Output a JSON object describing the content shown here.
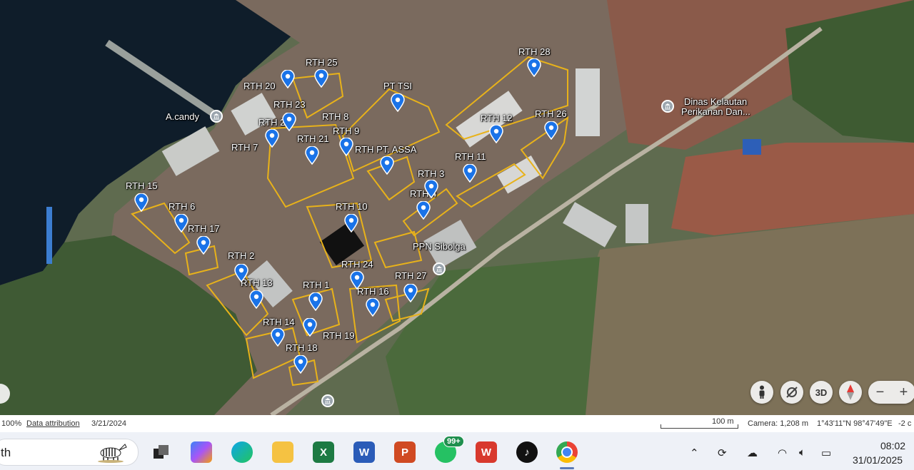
{
  "map": {
    "labels": [
      {
        "id": "rth-25",
        "text": "RTH 25"
      },
      {
        "id": "rth-28",
        "text": "RTH 28"
      },
      {
        "id": "rth-20",
        "text": "RTH 20"
      },
      {
        "id": "pt-tsi",
        "text": "PT TSI"
      },
      {
        "id": "rth-23",
        "text": "RTH 23"
      },
      {
        "id": "rth-8",
        "text": "RTH 8"
      },
      {
        "id": "rth-12",
        "text": "RTH 12"
      },
      {
        "id": "rth-26",
        "text": "RTH 26"
      },
      {
        "id": "rth-22",
        "text": "RTH 22"
      },
      {
        "id": "rth-9",
        "text": "RTH 9"
      },
      {
        "id": "rth-21",
        "text": "RTH 21"
      },
      {
        "id": "rth-7",
        "text": "RTH 7"
      },
      {
        "id": "rth-pt-assa",
        "text": "RTH PT. ASSA"
      },
      {
        "id": "rth-11",
        "text": "RTH 11"
      },
      {
        "id": "rth-3",
        "text": "RTH 3"
      },
      {
        "id": "rth-15",
        "text": "RTH 15"
      },
      {
        "id": "rth-4",
        "text": "RTH 4"
      },
      {
        "id": "rth-6",
        "text": "RTH 6"
      },
      {
        "id": "rth-10",
        "text": "RTH 10"
      },
      {
        "id": "rth-17",
        "text": "RTH 17"
      },
      {
        "id": "ppn-sibolga",
        "text": "PPN Sibolga"
      },
      {
        "id": "rth-2",
        "text": "RTH 2"
      },
      {
        "id": "rth-24",
        "text": "RTH 24"
      },
      {
        "id": "rth-27",
        "text": "RTH 27"
      },
      {
        "id": "rth-13",
        "text": "RTH 13"
      },
      {
        "id": "rth-1",
        "text": "RTH 1"
      },
      {
        "id": "rth-16",
        "text": "RTH 16"
      },
      {
        "id": "rth-14",
        "text": "RTH 14"
      },
      {
        "id": "rth-19",
        "text": "RTH 19"
      },
      {
        "id": "rth-18",
        "text": "RTH 18"
      },
      {
        "id": "a-candy",
        "text": "A.candy"
      },
      {
        "id": "dinas-1",
        "text": "Dinas Kelautan"
      },
      {
        "id": "dinas-2",
        "text": "Perikanan Dan..."
      }
    ],
    "controls": {
      "view_3d": "3D",
      "zoom_out": "−",
      "zoom_in": "+"
    },
    "colors": {
      "boundary": "#e8b21a",
      "pin": "#1a73e8"
    }
  },
  "status_bar": {
    "zoom": "100%",
    "data_attribution": "Data attribution",
    "imagery_date": "3/21/2024",
    "scale": "100 m",
    "camera": "Camera: 1,208 m",
    "coordinates": "1°43'11\"N 98°47'49\"E",
    "elevation": "-2 c"
  },
  "taskbar": {
    "search_text": "th",
    "whatsapp_badge": "99+",
    "time": "08:02",
    "date": "31/01/2025",
    "apps": [
      "copilot-icon",
      "edge-icon",
      "file-explorer-icon",
      "excel-icon",
      "word-icon",
      "powerpoint-icon",
      "whatsapp-icon",
      "wps-icon",
      "tiktok-icon",
      "chrome-icon"
    ]
  }
}
